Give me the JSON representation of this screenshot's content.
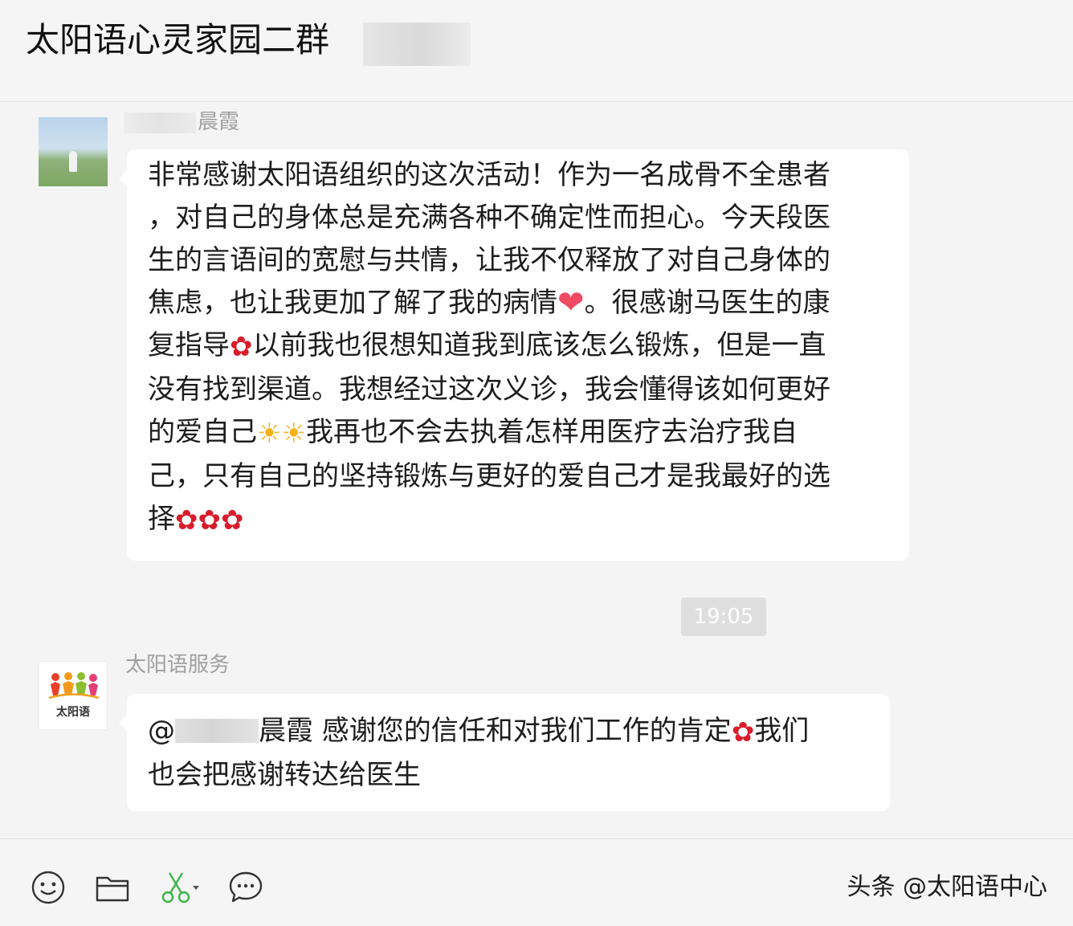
{
  "header": {
    "title": "太阳语心灵家园二群"
  },
  "messages": [
    {
      "sender": "晨霞",
      "avatar_icon": "landscape-avatar-icon",
      "lines": [
        [
          "非常感谢太阳语组织的这次活动！作为一名成骨不全患者"
        ],
        [
          "，对自己的身体总是充满各种不确定性而担心。今天段医"
        ],
        [
          "生的言语间的宽慰与共情，让我不仅释放了对自己身体的"
        ],
        [
          "焦虑，也让我更加了解了我的病情",
          "heart",
          "。很感谢马医生的康"
        ],
        [
          "复指导",
          "rose",
          "以前我也很想知道我到底该怎么锻炼，但是一直"
        ],
        [
          "没有找到渠道。我想经过这次义诊，我会懂得该如何更好"
        ],
        [
          "的爱自己",
          "sun",
          "sun",
          "我再也不会去执着怎样用医疗去治疗我自"
        ],
        [
          "己，只有自己的坚持锻炼与更好的爱自己才是我最好的选"
        ],
        [
          "择",
          "rose",
          "rose",
          "rose"
        ]
      ]
    },
    {
      "sender": "太阳语服务",
      "avatar_icon": "taiyangyu-logo-icon",
      "avatar_text": "太阳语",
      "line_1_after_mention": "晨霞 感谢您的信任和对我们工作的肯定",
      "line_1_after_rose": "我们",
      "line_2": "也会把感谢转达给医生",
      "mention_prefix": "@"
    }
  ],
  "timestamp": "19:05",
  "emoji": {
    "heart": "❤",
    "sun": "☀",
    "rose": "✿"
  },
  "toolbar": {
    "items": [
      "emoji-icon",
      "folder-icon",
      "scissors-icon",
      "chat-bubble-icon"
    ]
  },
  "watermark": "头条 @太阳语中心",
  "colors": {
    "background": "#f4f4f4",
    "bubble": "#ffffff",
    "sender_text": "#a0a0a0",
    "time_badge": "#dedede",
    "heart": "#f04a63",
    "sun": "#f7b21a",
    "rose": "#d81d2b",
    "scissors": "#3bb54a"
  }
}
